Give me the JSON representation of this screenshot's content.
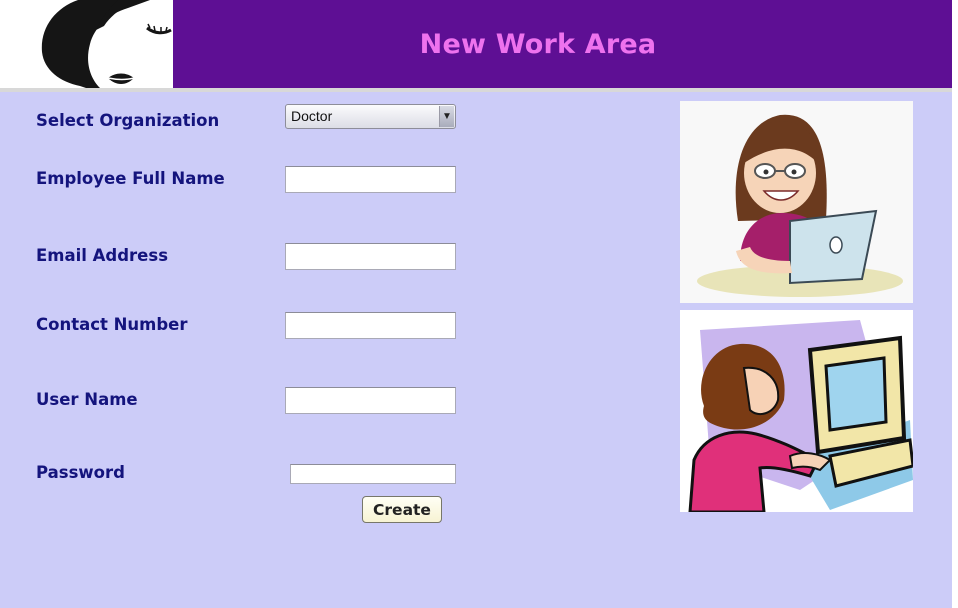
{
  "header": {
    "title": "New Work Area"
  },
  "form": {
    "organization_label": "Select Organization",
    "organization_selected": "Doctor",
    "full_name_label": "Employee Full Name",
    "full_name_value": "",
    "email_label": "Email Address",
    "email_value": "",
    "contact_label": "Contact Number",
    "contact_value": "",
    "username_label": "User Name",
    "username_value": "",
    "password_label": "Password",
    "password_value": "",
    "create_label": "Create"
  },
  "images": {
    "logo": "woman-face-logo",
    "illustration_top": "girl-with-laptop-illustration",
    "illustration_bottom": "woman-at-computer-illustration"
  },
  "colors": {
    "header_bg": "#5e0f94",
    "title_text": "#ee72ee",
    "panel_bg": "#ccccf8",
    "label_text": "#14147d"
  }
}
